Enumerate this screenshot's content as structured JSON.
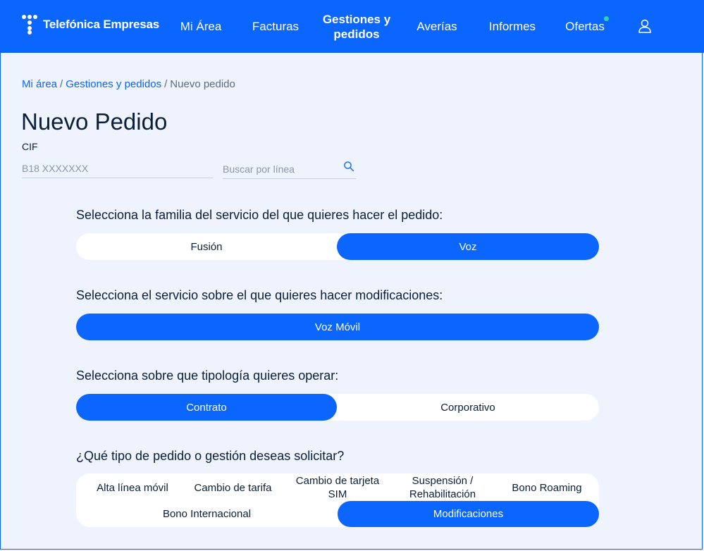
{
  "brand": {
    "name": "Telefónica Empresas"
  },
  "nav": {
    "items": [
      "Mi Área",
      "Facturas",
      "Gestiones y pedidos",
      "Averías",
      "Informes",
      "Ofertas"
    ],
    "active": "Gestiones y pedidos",
    "user_icon": "user-icon"
  },
  "breadcrumb": [
    "Mi área",
    "Gestiones y pedidos",
    "Nuevo pedido"
  ],
  "title": "Nuevo Pedido",
  "cif": {
    "label": "CIF",
    "value": "B18 XXXXXXX"
  },
  "search": {
    "placeholder": "Buscar por línea",
    "icon": "search-icon"
  },
  "questions": {
    "family": "Selecciona la familia del servicio del que quieres hacer el pedido:",
    "service": "Selecciona el servicio sobre el que quieres hacer modificaciones:",
    "type": "Selecciona sobre que tipología quieres operar:",
    "order": "¿Qué tipo de pedido o gestión deseas solicitar?"
  },
  "family_options": [
    "Fusión",
    "Voz"
  ],
  "family_selected": "Voz",
  "service_options": [
    "Voz Móvil"
  ],
  "service_selected": "Voz Móvil",
  "type_options": [
    "Contrato",
    "Corporativo"
  ],
  "type_selected": "Contrato",
  "order_options": [
    "Alta línea móvil",
    "Cambio de tarifa",
    "Cambio de tarjeta SIM",
    "Suspensión / Rehabilitación",
    "Bono Roaming",
    "Bono Internacional",
    "Modificaciones"
  ],
  "order_selected": "Modificaciones",
  "colors": {
    "primary": "#0b66ff",
    "background": "#eef3fd",
    "notification_dot": "#2ed3a7"
  }
}
